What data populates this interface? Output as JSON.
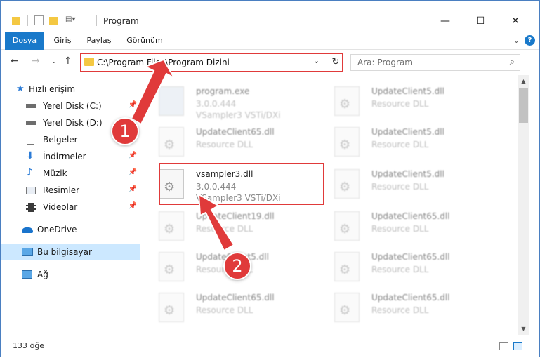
{
  "window": {
    "title": "Program"
  },
  "ribbon": {
    "tabs": [
      "Dosya",
      "Giriş",
      "Paylaş",
      "Görünüm"
    ],
    "active_tab": "Dosya"
  },
  "address": {
    "path": "C:\\Program Files\\Program Dizini"
  },
  "search": {
    "placeholder": "Ara: Program"
  },
  "sidebar": {
    "items": [
      {
        "label": "Hızlı erişim",
        "icon": "star-icon"
      },
      {
        "label": "Yerel Disk (C:)",
        "icon": "drive-icon",
        "pinned": true
      },
      {
        "label": "Yerel Disk (D:)",
        "icon": "drive-icon",
        "pinned": true
      },
      {
        "label": "Belgeler",
        "icon": "document-icon",
        "pinned": true
      },
      {
        "label": "İndirmeler",
        "icon": "download-icon",
        "pinned": true
      },
      {
        "label": "Müzik",
        "icon": "music-icon",
        "pinned": true
      },
      {
        "label": "Resimler",
        "icon": "pictures-icon",
        "pinned": true
      },
      {
        "label": "Videolar",
        "icon": "video-icon",
        "pinned": true
      },
      {
        "label": "OneDrive",
        "icon": "cloud-icon"
      },
      {
        "label": "Bu bilgisayar",
        "icon": "computer-icon",
        "selected": true
      },
      {
        "label": "Ağ",
        "icon": "network-icon"
      }
    ]
  },
  "files": {
    "left": [
      {
        "name": "program.exe",
        "line1": "3.0.0.444",
        "line2": "VSampler3 VSTi/DXi"
      },
      {
        "name": "UpdateClient65.dll",
        "line1": "Resource DLL"
      },
      {
        "name": "vsampler3.dll",
        "line1": "3.0.0.444",
        "line2": "VSampler3 VSTi/DXi"
      },
      {
        "name": "UpdateClient19.dll",
        "line1": "Resource DLL"
      },
      {
        "name": "UpdateClient5.dll",
        "line1": "Resource DLL"
      },
      {
        "name": "UpdateClient65.dll",
        "line1": "Resource DLL"
      }
    ],
    "right": [
      {
        "name": "UpdateClient5.dll",
        "line1": "Resource DLL"
      },
      {
        "name": "UpdateClient5.dll",
        "line1": "Resource DLL"
      },
      {
        "name": "UpdateClient5.dll",
        "line1": "Resource DLL"
      },
      {
        "name": "UpdateClient65.dll",
        "line1": "Resource DLL"
      },
      {
        "name": "UpdateClient65.dll",
        "line1": "Resource DLL"
      },
      {
        "name": "UpdateClient65.dll",
        "line1": "Resource DLL"
      }
    ]
  },
  "status": {
    "count": "133 öğe"
  },
  "annotations": {
    "step1": "1",
    "step2": "2"
  },
  "colors": {
    "accent": "#1979ca",
    "highlight": "#e03a3a",
    "selected_bg": "#cce8ff"
  }
}
